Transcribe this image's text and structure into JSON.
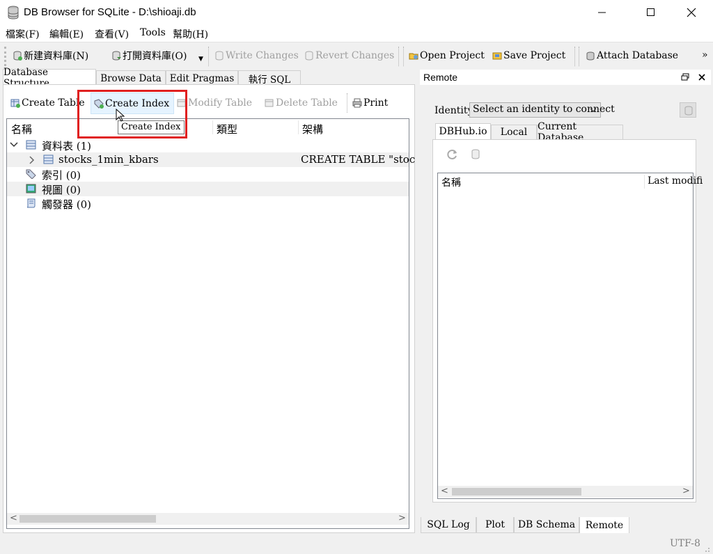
{
  "window": {
    "title": "DB Browser for SQLite - D:\\shioaji.db",
    "minimize_glyph": "—",
    "maximize_glyph": "☐",
    "close_glyph": "✕"
  },
  "menu": [
    "檔案(F)",
    "編輯(E)",
    "查看(V)",
    "Tools",
    "幫助(H)"
  ],
  "toolbar": {
    "new_db": "新建資料庫(N)",
    "open_db": "打開資料庫(O)",
    "write_changes": "Write Changes",
    "revert_changes": "Revert Changes",
    "open_project": "Open Project",
    "save_project": "Save Project",
    "attach_database": "Attach Database",
    "overflow": "»"
  },
  "main_tabs": [
    "Database Structure",
    "Browse Data",
    "Edit Pragmas",
    "執行 SQL"
  ],
  "structure_toolbar": {
    "create_table": "Create Table",
    "create_index": "Create Index",
    "modify_table": "Modify Table",
    "delete_table": "Delete Table",
    "print": "Print",
    "tooltip": "Create Index"
  },
  "tree": {
    "headers": [
      "名稱",
      "類型",
      "架構"
    ],
    "rows": [
      {
        "label": "資料表 (1)",
        "expanded": true
      },
      {
        "label": "stocks_1min_kbars",
        "schema": "CREATE TABLE \"stoc"
      },
      {
        "label": "索引 (0)"
      },
      {
        "label": "視圖 (0)"
      },
      {
        "label": "觸發器 (0)"
      }
    ]
  },
  "remote": {
    "title": "Remote",
    "identity_label": "Identity",
    "identity_select": "Select an identity to connect",
    "tabs": [
      "DBHub.io",
      "Local",
      "Current Database"
    ],
    "list_headers": [
      "名稱",
      "Last modifi"
    ]
  },
  "bottom_tabs": [
    "SQL Log",
    "Plot",
    "DB Schema",
    "Remote"
  ],
  "status": {
    "encoding": "UTF-8"
  },
  "colors": {
    "highlight_box": "#e02020",
    "hover_bg": "#e5f3ff"
  }
}
